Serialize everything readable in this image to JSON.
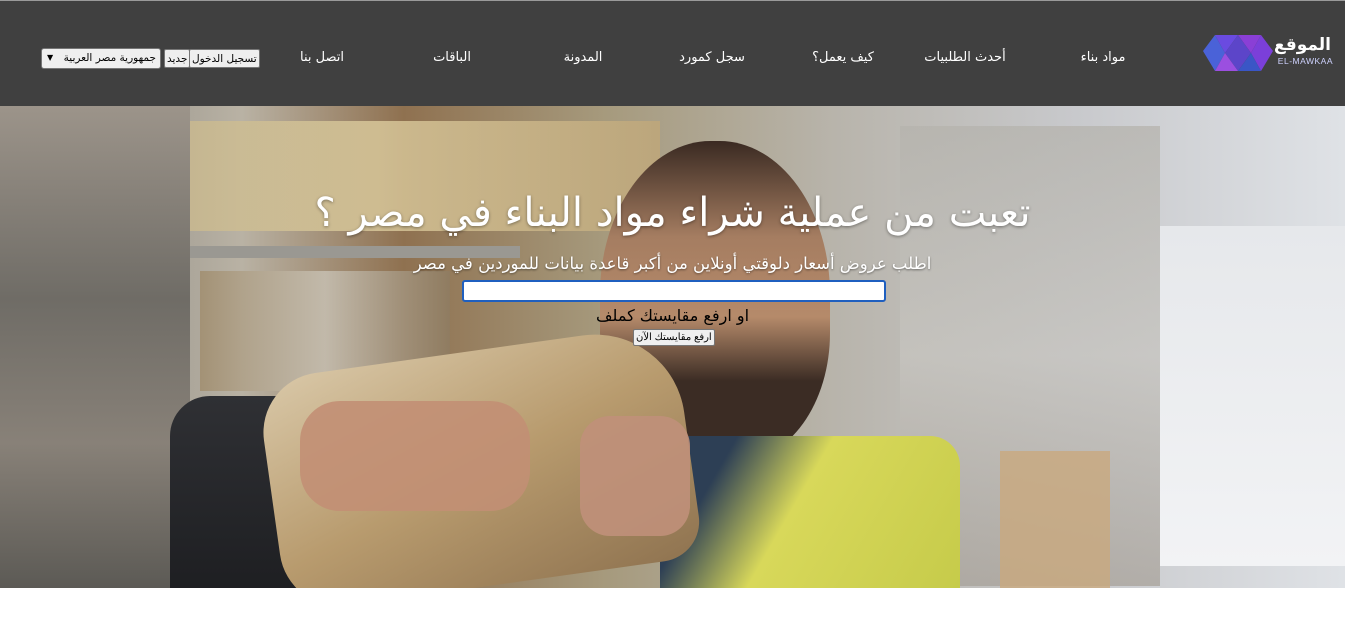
{
  "brand": {
    "name_ar": "الموقع",
    "name_en": "EL-MAWKAA"
  },
  "nav": [
    {
      "label": "مواد بناء"
    },
    {
      "label": "أحدث الطلبيات"
    },
    {
      "label": "كيف يعمل؟"
    },
    {
      "label": "سجل كمورد"
    },
    {
      "label": "المدونة"
    },
    {
      "label": "الباقات"
    },
    {
      "label": "اتصل بنا"
    }
  ],
  "header_actions": {
    "login_label": "تسجيل الدخول",
    "new_label": "جديد",
    "country_selected": "جمهورية مصر العربية"
  },
  "hero": {
    "title": "تعبت من عملية شراء مواد البناء في مصر ؟",
    "subtitle": "اطلب عروض أسعار دلوقتي أونلاين من أكبر قاعدة بيانات للموردين في مصر",
    "search_value": "",
    "alt_text": "او ارفع مقايستك كملف",
    "upload_label": "ارفع مقايستك الآن"
  },
  "colors": {
    "header_bg": "#404040",
    "logo_purple": "#7b3fd9",
    "logo_blue": "#4a62d8",
    "input_border": "#1f5fbf"
  },
  "icons": {
    "logo": "purple-blue-w-logo",
    "select_arrow": "chevron-down-icon"
  }
}
